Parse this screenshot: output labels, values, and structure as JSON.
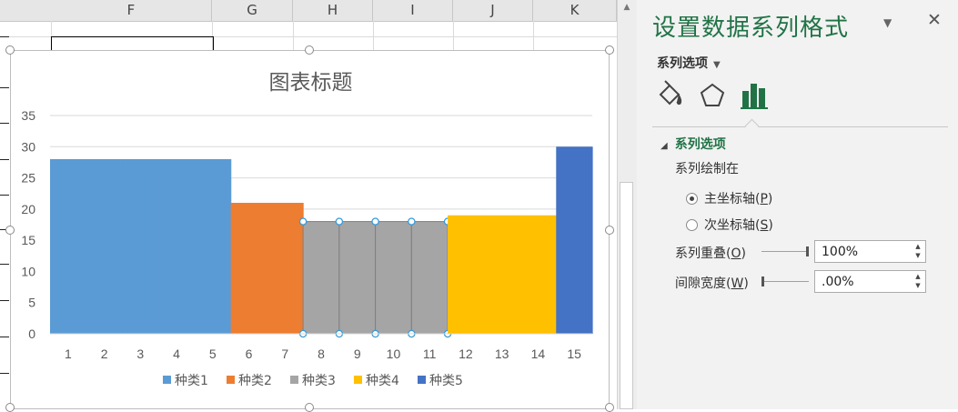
{
  "sheet": {
    "columns": [
      "F",
      "G",
      "H",
      "I",
      "J",
      "K"
    ]
  },
  "chart_data": {
    "type": "bar",
    "title": "图表标题",
    "categories": [
      "1",
      "2",
      "3",
      "4",
      "5",
      "6",
      "7",
      "8",
      "9",
      "10",
      "11",
      "12",
      "13",
      "14",
      "15"
    ],
    "ylim": [
      0,
      35
    ],
    "yticks": [
      "0",
      "5",
      "10",
      "15",
      "20",
      "25",
      "30",
      "35"
    ],
    "grid": true,
    "legend_position": "bottom",
    "series": [
      {
        "name": "种类1",
        "color": "#5b9bd5",
        "start": 0,
        "span": 5,
        "value": 28
      },
      {
        "name": "种类2",
        "color": "#ed7d31",
        "start": 5,
        "span": 2,
        "value": 21
      },
      {
        "name": "种类3",
        "color": "#a5a5a5",
        "start": 7,
        "span": 4,
        "value": 18,
        "selected": true
      },
      {
        "name": "种类4",
        "color": "#ffc000",
        "start": 11,
        "span": 3,
        "value": 19
      },
      {
        "name": "种类5",
        "color": "#4472c4",
        "start": 14,
        "span": 1,
        "value": 30
      }
    ]
  },
  "pane": {
    "title": "设置数据系列格式",
    "menu_label": "系列选项",
    "tabs": [
      "fill-line-icon",
      "effects-pentagon-icon",
      "series-options-bar-icon"
    ],
    "section_title": "系列选项",
    "plot_on_label": "系列绘制在",
    "primary_axis_label": "主坐标轴(",
    "primary_axis_key": "P",
    "secondary_axis_label": "次坐标轴(",
    "secondary_axis_key": "S",
    "paren_close": ")",
    "overlap_label": "系列重叠(",
    "overlap_key": "O",
    "overlap_value": "100%",
    "overlap_fraction": 1.0,
    "gap_label": "间隙宽度(",
    "gap_key": "W",
    "gap_value": ".00%",
    "gap_fraction": 0.0,
    "accent_color": "#217346"
  }
}
